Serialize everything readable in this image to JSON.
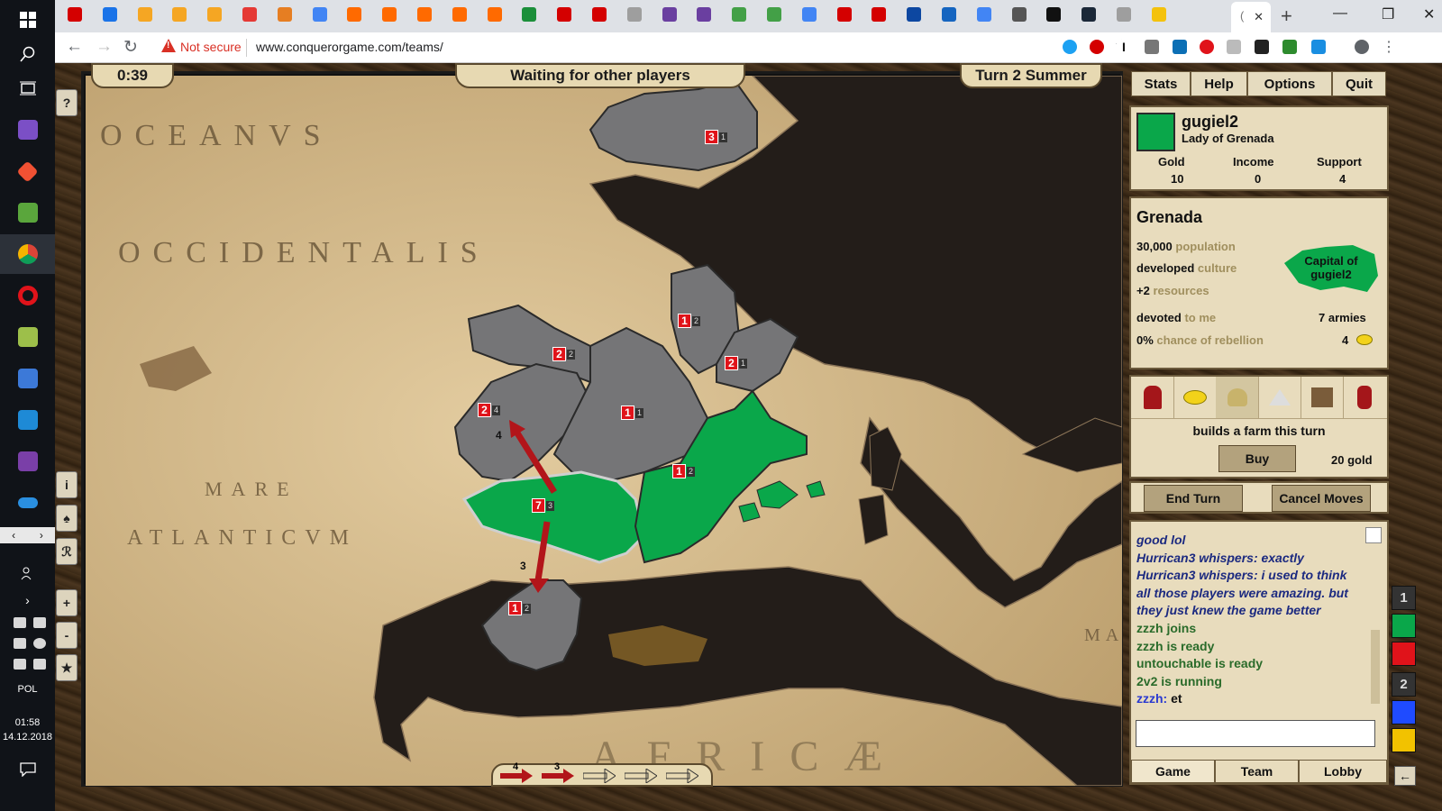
{
  "taskbar": {
    "lang": "POL",
    "time": "01:58",
    "date": "14.12.2018",
    "apps": [
      "visual-studio",
      "git",
      "notepad",
      "chrome",
      "opera",
      "tools",
      "save",
      "vscode",
      "onenote",
      "onedrive"
    ]
  },
  "browser": {
    "security_label": "Not secure",
    "url": "www.conquerorgame.com/teams/",
    "tab_icon_colors": [
      "#d40000",
      "#1a73e8",
      "#f5a623",
      "#f5a623",
      "#f5a623",
      "#e53935",
      "#e67e22",
      "#4285f4",
      "#ff6a00",
      "#ff6a00",
      "#ff6a00",
      "#ff6a00",
      "#ff6a00",
      "#1b8f3a",
      "#d40000",
      "#d40000",
      "#9e9e9e",
      "#6a3fa0",
      "#6a3fa0",
      "#43a047",
      "#43a047",
      "#4285f4",
      "#d40000",
      "#d40000",
      "#0d47a1",
      "#1565c0",
      "#4285f4",
      "#555555",
      "#111111",
      "#1b2838",
      "#9e9e9e",
      "#f4c20d"
    ]
  },
  "game": {
    "timer": "0:39",
    "status": "Waiting for other players",
    "turn": "Turn 2  Summer",
    "map_labels": [
      "OCEANVS",
      "OCCIDENTALIS",
      "MARE",
      "ATLANTICVM",
      "AFRICÆ",
      "MARE"
    ],
    "side_buttons": [
      "?",
      "i",
      "♠",
      "ℛ",
      "+",
      "-",
      "★"
    ],
    "armies": [
      {
        "n": "3",
        "s": "1"
      },
      {
        "n": "2",
        "s": "2"
      },
      {
        "n": "1",
        "s": "2"
      },
      {
        "n": "2",
        "s": "1"
      },
      {
        "n": "2",
        "s": "4"
      },
      {
        "n": "1",
        "s": "1"
      },
      {
        "n": "1",
        "s": "2"
      },
      {
        "n": "7",
        "s": "3"
      },
      {
        "n": "1",
        "s": "2"
      }
    ],
    "move_labels": [
      "4",
      "3"
    ],
    "queued_moves": [
      "4",
      "3"
    ]
  },
  "panel": {
    "tabs": [
      "Stats",
      "Help",
      "Options",
      "Quit"
    ],
    "player": {
      "name": "gugiel2",
      "title": "Lady of Grenada",
      "color": "#0aa74a",
      "gold_label": "Gold",
      "gold": "10",
      "income_label": "Income",
      "income": "0",
      "support_label": "Support",
      "support": "4"
    },
    "region": {
      "name": "Grenada",
      "population_value": "30,000",
      "population_label": "population",
      "culture_value": "developed",
      "culture_label": "culture",
      "resources_value": "+2",
      "resources_label": "resources",
      "devoted_value": "devoted",
      "devoted_label": "to me",
      "rebellion_value": "0%",
      "rebellion_label": "chance of rebellion",
      "capital_label": "Capital of gugiel2",
      "armies": "7 armies",
      "gold": "4"
    },
    "action": {
      "description": "builds a farm this turn",
      "buy_label": "Buy",
      "cost": "20 gold",
      "end_turn": "End Turn",
      "cancel_moves": "Cancel Moves"
    },
    "chat": [
      {
        "text": "good lol",
        "type": "whisper"
      },
      {
        "text": "Hurrican3 whispers: exactly",
        "type": "whisper"
      },
      {
        "text": "Hurrican3 whispers: i used to think",
        "type": "whisper"
      },
      {
        "text": "all those players were amazing. but",
        "type": "whisper"
      },
      {
        "text": "they just knew the game better",
        "type": "whisper"
      },
      {
        "text": "zzzh joins",
        "type": "sys"
      },
      {
        "text": "zzzh is ready",
        "type": "sys"
      },
      {
        "text": "untouchable is ready",
        "type": "sys"
      },
      {
        "text": "2v2 is running",
        "type": "sys"
      },
      {
        "text_user": "zzzh:",
        "text": "et",
        "type": "user"
      }
    ],
    "bottom_tabs": [
      "Game",
      "Team",
      "Lobby"
    ]
  },
  "teams": [
    {
      "label": "1",
      "color": "#333333"
    },
    {
      "label": "",
      "color": "#0aa74a"
    },
    {
      "label": "",
      "color": "#e0131a"
    },
    {
      "label": "2",
      "color": "#333333"
    },
    {
      "label": "",
      "color": "#1f4bff"
    },
    {
      "label": "",
      "color": "#f2c200"
    }
  ],
  "scroll_arrow": "←"
}
